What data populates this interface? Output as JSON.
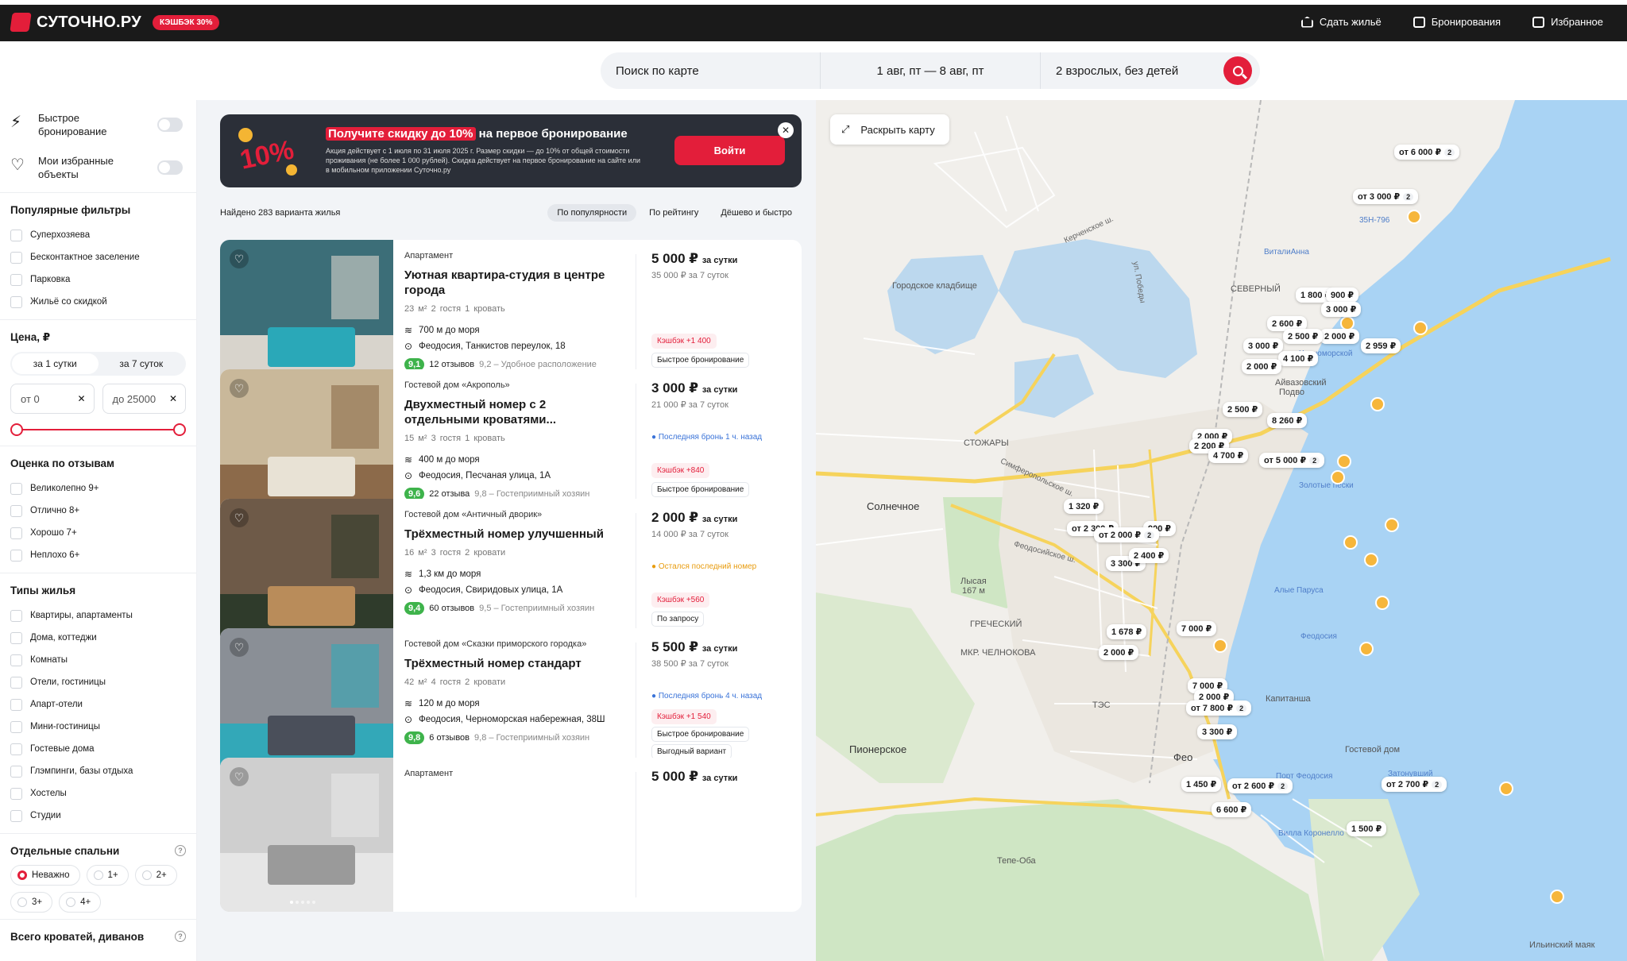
{
  "header": {
    "logo": "СУТОЧНО.РУ",
    "cashback": "КЭШБЭК 30%",
    "links": [
      "Сдать жильё",
      "Бронирования",
      "Избранное"
    ]
  },
  "search": {
    "location": "Поиск по карте",
    "dates": "1 авг, пт — 8 авг, пт",
    "guests": "2 взрослых, без детей"
  },
  "sidebar": {
    "toggles": [
      {
        "label": "Быстрое бронирование"
      },
      {
        "label": "Мои избранные объекты"
      }
    ],
    "popular_title": "Популярные фильтры",
    "popular": [
      "Суперхозяева",
      "Бесконтактное заселение",
      "Парковка",
      "Жильё со скидкой"
    ],
    "price_title": "Цена, ₽",
    "price_tabs": [
      "за 1 сутки",
      "за 7 суток"
    ],
    "price_from": "от  0",
    "price_to": "до  25000",
    "rating_title": "Оценка по отзывам",
    "ratings": [
      "Великолепно 9+",
      "Отлично 8+",
      "Хорошо 7+",
      "Неплохо 6+"
    ],
    "types_title": "Типы жилья",
    "types": [
      "Квартиры, апартаменты",
      "Дома, коттеджи",
      "Комнаты",
      "Отели, гостиницы",
      "Апарт-отели",
      "Мини-гостиницы",
      "Гостевые дома",
      "Глэмпинги, базы отдыха",
      "Хостелы",
      "Студии"
    ],
    "beds_title": "Отдельные спальни",
    "beds": [
      "Неважно",
      "1+",
      "2+",
      "3+",
      "4+"
    ],
    "more_title": "Всего кроватей, диванов"
  },
  "promo": {
    "title_hl": "Получите скидку до 10%",
    "title_rest": " на первое бронирование",
    "desc": "Акция действует с 1 июля по 31 июля 2025 г. Размер скидки — до 10% от общей стоимости проживания (не более 1 000 рублей). Скидка действует на первое бронирование на сайте или в мобильном приложении Суточно.ру",
    "button": "Войти",
    "art": "10%"
  },
  "list": {
    "found": "Найдено 283 варианта жилья",
    "sort": [
      "По популярности",
      "По рейтингу",
      "Дёшево и быстро"
    ]
  },
  "cards": [
    {
      "type": "Апартамент",
      "title": "Уютная квартира-студия в центре города",
      "meta": "23 м²   2 гостя   1 кровать",
      "sea": "700 м до моря",
      "address": "Феодосия, Танкистов переулок, 18",
      "rating": "9,1",
      "reviews": "12 отзывов",
      "rating_extra": "9,2 – Удобное расположение",
      "price": "5 000 ₽",
      "per": "за сутки",
      "total": "35 000 ₽ за 7 суток",
      "note": "",
      "cashback": "Кэшбэк +1 400",
      "badge2": "Быстрое бронирование"
    },
    {
      "type": "Гостевой дом «Акрополь»",
      "title": "Двухместный номер с 2 отдельными кроватями...",
      "meta": "15 м²   3 гостя   1 кровать",
      "sea": "400 м до моря",
      "address": "Феодосия, Песчаная улица, 1А",
      "rating": "9,6",
      "reviews": "22 отзыва",
      "rating_extra": "9,8 – Гостеприимный хозяин",
      "price": "3 000 ₽",
      "per": "за сутки",
      "total": "21 000 ₽ за 7 суток",
      "note": "Последняя бронь 1 ч. назад",
      "cashback": "Кэшбэк +840",
      "badge2": "Быстрое бронирование"
    },
    {
      "type": "Гостевой дом «Античный дворик»",
      "title": "Трёхместный номер улучшенный",
      "meta": "16 м²   3 гостя   2 кровати",
      "sea": "1,3 км до моря",
      "address": "Феодосия, Свиридовых улица, 1А",
      "rating": "9,4",
      "reviews": "60 отзывов",
      "rating_extra": "9,5 – Гостеприимный хозяин",
      "price": "2 000 ₽",
      "per": "за сутки",
      "total": "14 000 ₽ за 7 суток",
      "note": "Остался последний номер",
      "cashback": "Кэшбэк +560",
      "badge2": "По запросу"
    },
    {
      "type": "Гостевой дом «Сказки приморского городка»",
      "title": "Трёхместный номер стандарт",
      "meta": "42 м²   4 гостя   2 кровати",
      "sea": "120 м до моря",
      "address": "Феодосия, Черноморская набережная, 38Ш",
      "rating": "9,8",
      "reviews": "6 отзывов",
      "rating_extra": "9,8 – Гостеприимный хозяин",
      "price": "5 500 ₽",
      "per": "за сутки",
      "total": "38 500 ₽ за 7 суток",
      "note": "Последняя бронь 4 ч. назад",
      "cashback": "Кэшбэк +1 540",
      "badge2": "Быстрое бронирование",
      "badge3": "Выгодный вариант"
    },
    {
      "type": "Апартамент",
      "title": "",
      "meta": "",
      "sea": "",
      "address": "",
      "rating": "",
      "reviews": "",
      "rating_extra": "",
      "price": "5 000 ₽",
      "per": "за сутки",
      "total": "",
      "note": "",
      "cashback": "",
      "badge2": ""
    }
  ],
  "map": {
    "expand": "Раскрыть карту",
    "places": [
      "Солнечное",
      "Пионерское",
      "Тепе-Оба",
      "Лысая",
      "167 м",
      "Городское кладбище",
      "СЕВЕРНЫЙ",
      "СТОЖАРЫ",
      "ГРЕЧЕСКИЙ",
      "МКР. ЧЕЛНОКОВА",
      "ТЭС",
      "Фео",
      "Черноморской",
      "Айвазовский",
      "Подво",
      "Золотые пески",
      "Алые Паруса",
      "Феодосия",
      "Порт Феодосия",
      "Вилла Коронелло",
      "Затонувший",
      "Ильинский маяк",
      "ВиталиАнна",
      "Гостевой дом",
      "Капитанша",
      "35Н-796"
    ],
    "roads": [
      "Керченское ш.",
      "Симферопольское ш.",
      "ул. Победы",
      "Феодосийское ш."
    ],
    "pins": [
      {
        "t": "от 6 000 ₽",
        "n": "2"
      },
      {
        "t": "от 3 000 ₽",
        "n": "2"
      },
      {
        "t": "1 800 ₽"
      },
      {
        "t": "900 ₽"
      },
      {
        "t": "3 000 ₽"
      },
      {
        "t": "2 600 ₽"
      },
      {
        "t": "2 000 ₽"
      },
      {
        "t": "2 500 ₽"
      },
      {
        "t": "2 959 ₽"
      },
      {
        "t": "3 000 ₽"
      },
      {
        "t": "4 100 ₽"
      },
      {
        "t": "2 000 ₽"
      },
      {
        "t": "2 500 ₽"
      },
      {
        "t": "8 260 ₽"
      },
      {
        "t": "2 000 ₽"
      },
      {
        "t": "2 200 ₽"
      },
      {
        "t": "4 700 ₽"
      },
      {
        "t": "от 5 000 ₽",
        "n": "2"
      },
      {
        "t": "1 320 ₽"
      },
      {
        "t": "900 ₽"
      },
      {
        "t": "от 2 300 ₽"
      },
      {
        "t": "от 2 000 ₽",
        "n": "2"
      },
      {
        "t": "3 300 ₽"
      },
      {
        "t": "2 400 ₽"
      },
      {
        "t": "1 678 ₽"
      },
      {
        "t": "7 000 ₽"
      },
      {
        "t": "2 000 ₽"
      },
      {
        "t": "7 000 ₽"
      },
      {
        "t": "2 000 ₽"
      },
      {
        "t": "от 7 800 ₽",
        "n": "2"
      },
      {
        "t": "3 300 ₽"
      },
      {
        "t": "1 450 ₽"
      },
      {
        "t": "от 2 600 ₽",
        "n": "2"
      },
      {
        "t": "от 2 700 ₽",
        "n": "2"
      },
      {
        "t": "6 600 ₽"
      },
      {
        "t": "1 500 ₽"
      }
    ]
  },
  "colors": {
    "brand": "#e31e3a",
    "rating": "#3eb34b",
    "sea": "#a9d3f4",
    "land": "#f1efeb",
    "green": "#cfe6c4"
  }
}
